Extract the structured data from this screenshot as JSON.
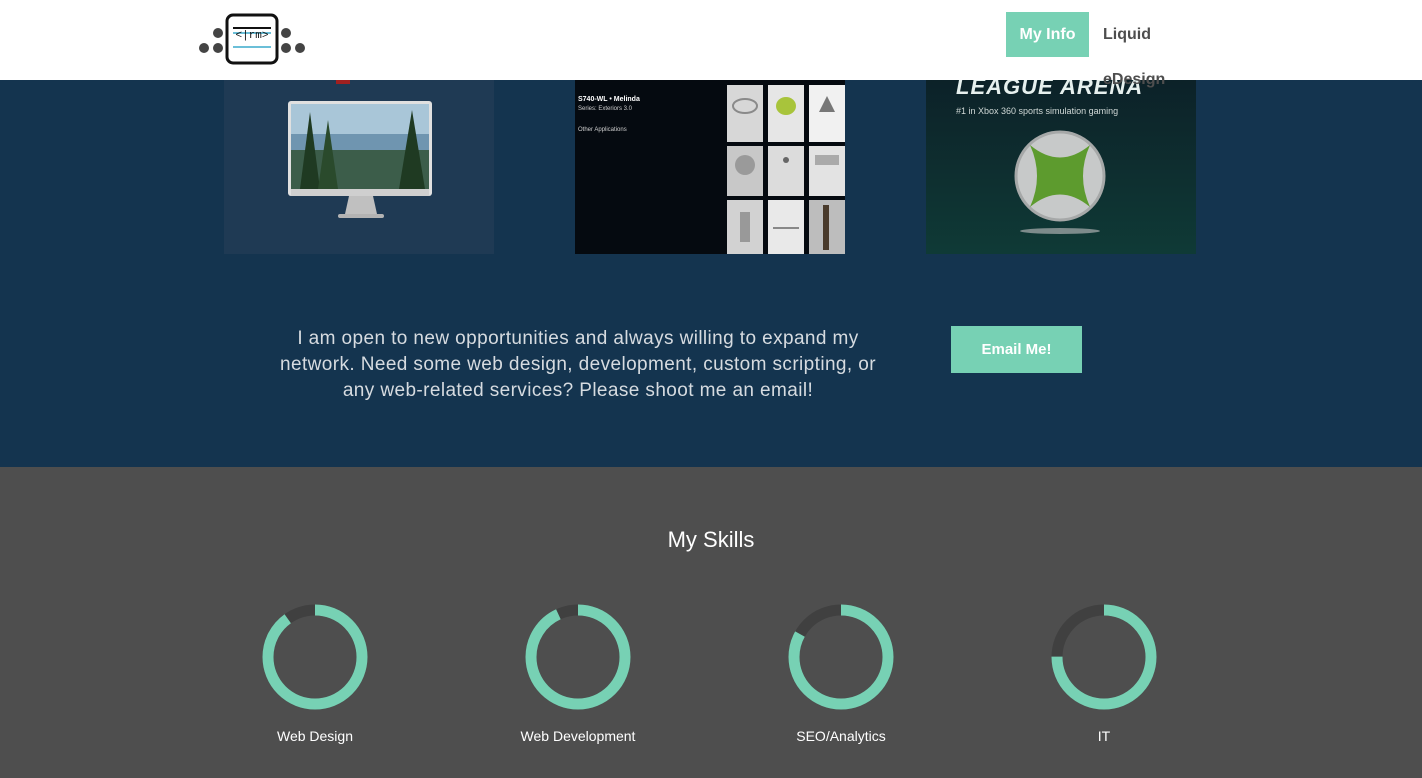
{
  "nav": {
    "logo_text": "<|rm>",
    "items": [
      {
        "label": "My Info",
        "active": true
      },
      {
        "label": "Liquid eDesign",
        "active": false
      }
    ]
  },
  "portfolio": {
    "thumbnails": [
      {
        "icon": "monitor-lake-image"
      },
      {
        "icon": "lighting-catalog-image",
        "lines": [
          "S740-WL • Melinda",
          "Series: Exteriors 3.0",
          "Other Applications"
        ]
      },
      {
        "icon": "xbox-league-image",
        "heading": "LEAGUE ARENA",
        "tagline": "#1 in Xbox 360 sports simulation gaming"
      }
    ]
  },
  "cta": {
    "message": "I am open to new opportunities and always willing to expand my network. Need some web design, development, custom scripting, or any web-related services? Please shoot me an email!",
    "button": "Email Me!"
  },
  "skills": {
    "title": "My Skills",
    "items": [
      {
        "label": "Web Design",
        "level": 0.9
      },
      {
        "label": "Web Development",
        "level": 0.93
      },
      {
        "label": "SEO/Analytics",
        "level": 0.83
      },
      {
        "label": "IT",
        "level": 0.75
      }
    ]
  },
  "colors": {
    "accent": "#77d1b4",
    "navy": "#14344f",
    "gray": "#4e4e4e",
    "ring_track": "#404040"
  }
}
